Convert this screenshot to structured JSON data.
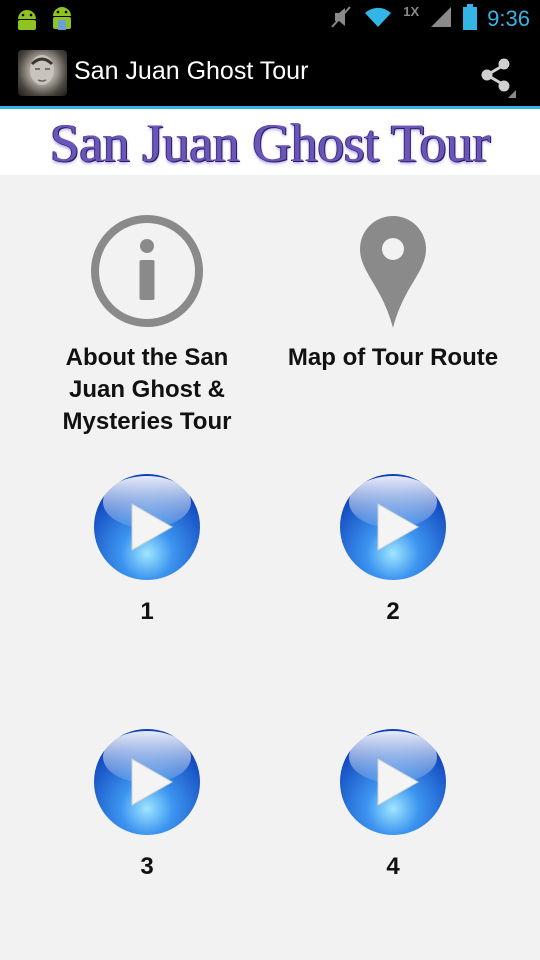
{
  "status_bar": {
    "time": "9:36",
    "network_label": "1X"
  },
  "action_bar": {
    "title": "San Juan Ghost Tour"
  },
  "banner": {
    "text": "San Juan Ghost Tour"
  },
  "menu": {
    "about_label": "About the San Juan Ghost & Mysteries Tour",
    "map_label": "Map of Tour Route"
  },
  "tracks": [
    {
      "label": "1"
    },
    {
      "label": "2"
    },
    {
      "label": "3"
    },
    {
      "label": "4"
    }
  ],
  "colors": {
    "accent": "#33b5e5",
    "icon_gray": "#8a8a8a",
    "play_blue": "#1e6fe0"
  }
}
